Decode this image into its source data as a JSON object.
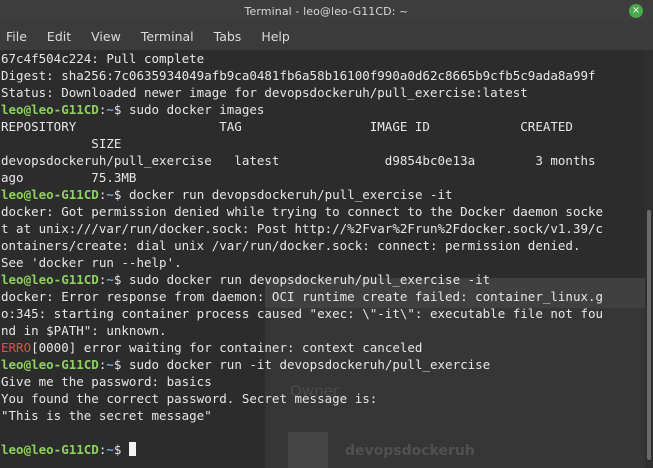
{
  "window": {
    "title": "Terminal - leo@leo-G11CD: ~",
    "close_glyph": "×"
  },
  "menu": [
    "File",
    "Edit",
    "View",
    "Terminal",
    "Tabs",
    "Help"
  ],
  "background_page": {
    "owner_label": "Owner",
    "owner_name": "devopsdockeruh"
  },
  "terminal": {
    "prompt_user": "leo@leo-G11CD",
    "prompt_sep": ":",
    "prompt_path": "~",
    "prompt_symbol": "$ ",
    "lines": [
      {
        "type": "out",
        "text": "67c4f504c224: Pull complete"
      },
      {
        "type": "out",
        "text": "Digest: sha256:7c0635934049afb9ca0481fb6a58b16100f990a0d62c8665b9cfb5c9ada8a99f"
      },
      {
        "type": "out",
        "text": "Status: Downloaded newer image for devopsdockeruh/pull_exercise:latest"
      },
      {
        "type": "cmd",
        "text": "sudo docker images"
      },
      {
        "type": "out",
        "text": "REPOSITORY                   TAG                 IMAGE ID            CREATED"
      },
      {
        "type": "out",
        "text": "            SIZE"
      },
      {
        "type": "out",
        "text": "devopsdockeruh/pull_exercise   latest              d9854bc0e13a        3 months"
      },
      {
        "type": "out",
        "text": "ago         75.3MB"
      },
      {
        "type": "cmd",
        "text": "docker run devopsdockeruh/pull_exercise -it"
      },
      {
        "type": "out",
        "text": "docker: Got permission denied while trying to connect to the Docker daemon socke"
      },
      {
        "type": "out",
        "text": "t at unix:///var/run/docker.sock: Post http://%2Fvar%2Frun%2Fdocker.sock/v1.39/c"
      },
      {
        "type": "out",
        "text": "ontainers/create: dial unix /var/run/docker.sock: connect: permission denied."
      },
      {
        "type": "out",
        "text": "See 'docker run --help'."
      },
      {
        "type": "cmd",
        "text": "sudo docker run devopsdockeruh/pull_exercise -it"
      },
      {
        "type": "out",
        "text": "docker: Error response from daemon: OCI runtime create failed: container_linux.g"
      },
      {
        "type": "out",
        "text": "o:345: starting container process caused \"exec: \\\"-it\\\": executable file not fou"
      },
      {
        "type": "out",
        "text": "nd in $PATH\": unknown."
      },
      {
        "type": "err",
        "errtag": "ERRO",
        "text": "[0000] error waiting for container: context canceled"
      },
      {
        "type": "cmd",
        "text": "sudo docker run -it devopsdockeruh/pull_exercise"
      },
      {
        "type": "out",
        "text": "Give me the password: basics"
      },
      {
        "type": "out",
        "text": "You found the correct password. Secret message is:"
      },
      {
        "type": "out",
        "text": "\"This is the secret message\""
      },
      {
        "type": "out",
        "text": ""
      },
      {
        "type": "cursor",
        "text": ""
      }
    ]
  },
  "colors": {
    "prompt_user": "#8ed160",
    "prompt_path": "#79a6dc",
    "error_tag": "#e64d4d",
    "terminal_bg": "#2c2c2c",
    "terminal_fg": "#e6e6e6"
  }
}
